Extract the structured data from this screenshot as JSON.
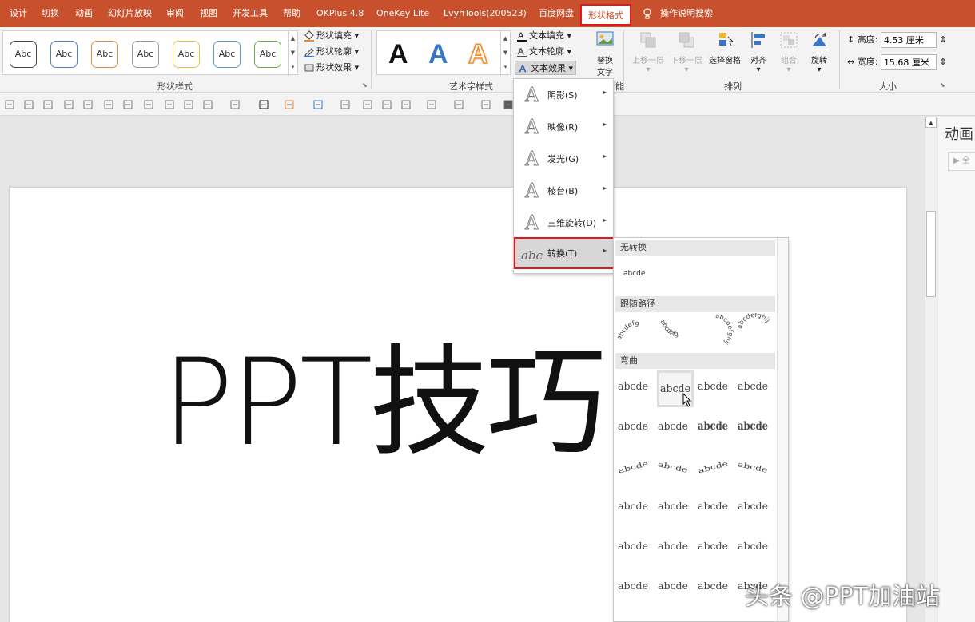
{
  "tabs": [
    {
      "label": "设计"
    },
    {
      "label": "切换"
    },
    {
      "label": "动画"
    },
    {
      "label": "幻灯片放映"
    },
    {
      "label": "审阅"
    },
    {
      "label": "视图"
    },
    {
      "label": "开发工具"
    },
    {
      "label": "帮助"
    },
    {
      "label": "OKPlus 4.8"
    },
    {
      "label": "OneKey Lite"
    },
    {
      "label": "LvyhTools(200523)"
    },
    {
      "label": "百度网盘"
    },
    {
      "label": "形状格式",
      "active": true
    }
  ],
  "tell_me": "操作说明搜索",
  "ribbon": {
    "shape_styles": {
      "swatches": [
        "Abc",
        "Abc",
        "Abc",
        "Abc",
        "Abc",
        "Abc",
        "Abc"
      ],
      "swatch_colors": [
        "#444444",
        "#4f81bd",
        "#e28c3c",
        "#9a9a9a",
        "#e8c24a",
        "#5b9bd5",
        "#6ab04c"
      ],
      "fill": "形状填充",
      "outline": "形状轮廓",
      "effects": "形状效果",
      "label": "形状样式"
    },
    "wordart": {
      "letters": [
        "A",
        "A",
        "A"
      ],
      "colors": [
        "#111111",
        "#3a76c4",
        "#f08a2c"
      ],
      "text_fill": "文本填充",
      "text_outline": "文本轮廓",
      "text_effects": "文本效果",
      "label": "艺术字样式"
    },
    "alt_text": {
      "line1": "替换",
      "line2": "文字",
      "group_label_tail": "能"
    },
    "arrange": {
      "bring_forward": "上移一层",
      "send_backward": "下移一层",
      "selection_pane": "选择窗格",
      "align": "对齐",
      "group": "组合",
      "rotate": "旋转",
      "label": "排列"
    },
    "size": {
      "height_label": "高度:",
      "height_value": "4.53 厘米",
      "width_label": "宽度:",
      "width_value": "15.68 厘米",
      "label": "大小"
    }
  },
  "slide": {
    "text": "PPT技巧"
  },
  "anim_pane": {
    "title": "动画",
    "play": "全"
  },
  "effects_menu": {
    "items": [
      {
        "label": "阴影(S)",
        "icon": "shadow-a-icon"
      },
      {
        "label": "映像(R)",
        "icon": "reflection-a-icon"
      },
      {
        "label": "发光(G)",
        "icon": "glow-a-icon"
      },
      {
        "label": "棱台(B)",
        "icon": "bevel-a-icon"
      },
      {
        "label": "三维旋转(D)",
        "icon": "3d-rotation-a-icon"
      },
      {
        "label": "转换(T)",
        "icon": "transform-abc-icon",
        "selected": true
      }
    ]
  },
  "transform_panel": {
    "no_transform": "无转换",
    "sample": "abcde",
    "follow_path": "跟随路径",
    "path_samples": [
      "abcdefg",
      "abcdefg",
      "abcdefghij",
      "abcdefghij"
    ],
    "warp": "弯曲",
    "warp_rows": [
      [
        "abcde",
        "abcde",
        "abcde",
        "abcde"
      ],
      [
        "abcde",
        "abcde",
        "abcde",
        "abcde"
      ],
      [
        "abcde",
        "abcde",
        "abcde",
        "abcde"
      ],
      [
        "abcde",
        "abcde",
        "abcde",
        "abcde"
      ],
      [
        "abcde",
        "abcde",
        "abcde",
        "abcde"
      ],
      [
        "abcde",
        "abcde",
        "abcde",
        "abcde"
      ]
    ]
  },
  "watermark": "头条 @PPT加油站",
  "colors": {
    "accent": "#c9502c",
    "highlight": "#e01a1a"
  }
}
